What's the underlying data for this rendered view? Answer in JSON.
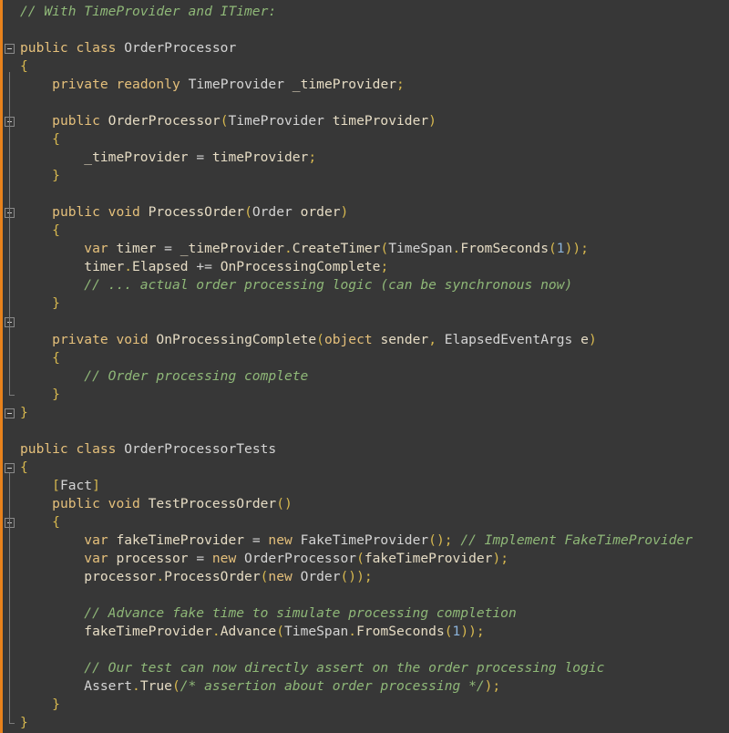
{
  "editor": {
    "language": "csharp",
    "colors": {
      "background": "#373737",
      "accent_bar": "#e8821c",
      "keyword": "#e5c07b",
      "comment": "#8fb878",
      "text": "#d4d4d4",
      "number": "#8cb4dc"
    },
    "fold_markers": [
      3,
      7,
      12,
      18,
      23,
      26,
      29
    ]
  },
  "lines": [
    [
      [
        "cm",
        "// With TimeProvider and ITimer:"
      ]
    ],
    [],
    [
      [
        "kw",
        "public"
      ],
      [
        "op",
        " "
      ],
      [
        "kw",
        "class"
      ],
      [
        "op",
        " "
      ],
      [
        "ty",
        "OrderProcessor"
      ]
    ],
    [
      [
        "pn",
        "{"
      ]
    ],
    [
      [
        "op",
        "    "
      ],
      [
        "kw",
        "private"
      ],
      [
        "op",
        " "
      ],
      [
        "kw",
        "readonly"
      ],
      [
        "op",
        " "
      ],
      [
        "ty",
        "TimeProvider"
      ],
      [
        "op",
        " "
      ],
      [
        "id",
        "_timeProvider"
      ],
      [
        "pn",
        ";"
      ]
    ],
    [],
    [
      [
        "op",
        "    "
      ],
      [
        "kw",
        "public"
      ],
      [
        "op",
        " "
      ],
      [
        "fn",
        "OrderProcessor"
      ],
      [
        "pn",
        "("
      ],
      [
        "ty",
        "TimeProvider"
      ],
      [
        "op",
        " "
      ],
      [
        "id",
        "timeProvider"
      ],
      [
        "pn",
        ")"
      ]
    ],
    [
      [
        "op",
        "    "
      ],
      [
        "pn",
        "{"
      ]
    ],
    [
      [
        "op",
        "        "
      ],
      [
        "id",
        "_timeProvider"
      ],
      [
        "op",
        " = "
      ],
      [
        "id",
        "timeProvider"
      ],
      [
        "pn",
        ";"
      ]
    ],
    [
      [
        "op",
        "    "
      ],
      [
        "pn",
        "}"
      ]
    ],
    [],
    [
      [
        "op",
        "    "
      ],
      [
        "kw",
        "public"
      ],
      [
        "op",
        " "
      ],
      [
        "kw",
        "void"
      ],
      [
        "op",
        " "
      ],
      [
        "fn",
        "ProcessOrder"
      ],
      [
        "pn",
        "("
      ],
      [
        "ty",
        "Order"
      ],
      [
        "op",
        " "
      ],
      [
        "id",
        "order"
      ],
      [
        "pn",
        ")"
      ]
    ],
    [
      [
        "op",
        "    "
      ],
      [
        "pn",
        "{"
      ]
    ],
    [
      [
        "op",
        "        "
      ],
      [
        "kw",
        "var"
      ],
      [
        "op",
        " "
      ],
      [
        "id",
        "timer"
      ],
      [
        "op",
        " = "
      ],
      [
        "id",
        "_timeProvider"
      ],
      [
        "pn",
        "."
      ],
      [
        "fn",
        "CreateTimer"
      ],
      [
        "pn",
        "("
      ],
      [
        "ty",
        "TimeSpan"
      ],
      [
        "pn",
        "."
      ],
      [
        "fn",
        "FromSeconds"
      ],
      [
        "pn",
        "("
      ],
      [
        "nm",
        "1"
      ],
      [
        "pn",
        "));"
      ]
    ],
    [
      [
        "op",
        "        "
      ],
      [
        "id",
        "timer"
      ],
      [
        "pn",
        "."
      ],
      [
        "id",
        "Elapsed"
      ],
      [
        "op",
        " += "
      ],
      [
        "id",
        "OnProcessingComplete"
      ],
      [
        "pn",
        ";"
      ]
    ],
    [
      [
        "op",
        "        "
      ],
      [
        "cm",
        "// ... actual order processing logic (can be synchronous now)"
      ]
    ],
    [
      [
        "op",
        "    "
      ],
      [
        "pn",
        "}"
      ]
    ],
    [],
    [
      [
        "op",
        "    "
      ],
      [
        "kw",
        "private"
      ],
      [
        "op",
        " "
      ],
      [
        "kw",
        "void"
      ],
      [
        "op",
        " "
      ],
      [
        "fn",
        "OnProcessingComplete"
      ],
      [
        "pn",
        "("
      ],
      [
        "kw",
        "object"
      ],
      [
        "op",
        " "
      ],
      [
        "id",
        "sender"
      ],
      [
        "pn",
        ", "
      ],
      [
        "ty",
        "ElapsedEventArgs"
      ],
      [
        "op",
        " "
      ],
      [
        "id",
        "e"
      ],
      [
        "pn",
        ")"
      ]
    ],
    [
      [
        "op",
        "    "
      ],
      [
        "pn",
        "{"
      ]
    ],
    [
      [
        "op",
        "        "
      ],
      [
        "cm",
        "// Order processing complete"
      ]
    ],
    [
      [
        "op",
        "    "
      ],
      [
        "pn",
        "}"
      ]
    ],
    [
      [
        "pn",
        "}"
      ]
    ],
    [],
    [
      [
        "kw",
        "public"
      ],
      [
        "op",
        " "
      ],
      [
        "kw",
        "class"
      ],
      [
        "op",
        " "
      ],
      [
        "ty",
        "OrderProcessorTests"
      ]
    ],
    [
      [
        "pn",
        "{"
      ]
    ],
    [
      [
        "op",
        "    "
      ],
      [
        "at",
        "["
      ],
      [
        "ty",
        "Fact"
      ],
      [
        "at",
        "]"
      ]
    ],
    [
      [
        "op",
        "    "
      ],
      [
        "kw",
        "public"
      ],
      [
        "op",
        " "
      ],
      [
        "kw",
        "void"
      ],
      [
        "op",
        " "
      ],
      [
        "fn",
        "TestProcessOrder"
      ],
      [
        "pn",
        "()"
      ]
    ],
    [
      [
        "op",
        "    "
      ],
      [
        "pn",
        "{"
      ]
    ],
    [
      [
        "op",
        "        "
      ],
      [
        "kw",
        "var"
      ],
      [
        "op",
        " "
      ],
      [
        "id",
        "fakeTimeProvider"
      ],
      [
        "op",
        " = "
      ],
      [
        "kw",
        "new"
      ],
      [
        "op",
        " "
      ],
      [
        "ty",
        "FakeTimeProvider"
      ],
      [
        "pn",
        "();"
      ],
      [
        "op",
        " "
      ],
      [
        "cm",
        "// Implement FakeTimeProvider"
      ]
    ],
    [
      [
        "op",
        "        "
      ],
      [
        "kw",
        "var"
      ],
      [
        "op",
        " "
      ],
      [
        "id",
        "processor"
      ],
      [
        "op",
        " = "
      ],
      [
        "kw",
        "new"
      ],
      [
        "op",
        " "
      ],
      [
        "ty",
        "OrderProcessor"
      ],
      [
        "pn",
        "("
      ],
      [
        "id",
        "fakeTimeProvider"
      ],
      [
        "pn",
        ");"
      ]
    ],
    [
      [
        "op",
        "        "
      ],
      [
        "id",
        "processor"
      ],
      [
        "pn",
        "."
      ],
      [
        "fn",
        "ProcessOrder"
      ],
      [
        "pn",
        "("
      ],
      [
        "kw",
        "new"
      ],
      [
        "op",
        " "
      ],
      [
        "ty",
        "Order"
      ],
      [
        "pn",
        "());"
      ]
    ],
    [],
    [
      [
        "op",
        "        "
      ],
      [
        "cm",
        "// Advance fake time to simulate processing completion"
      ]
    ],
    [
      [
        "op",
        "        "
      ],
      [
        "id",
        "fakeTimeProvider"
      ],
      [
        "pn",
        "."
      ],
      [
        "fn",
        "Advance"
      ],
      [
        "pn",
        "("
      ],
      [
        "ty",
        "TimeSpan"
      ],
      [
        "pn",
        "."
      ],
      [
        "fn",
        "FromSeconds"
      ],
      [
        "pn",
        "("
      ],
      [
        "nm",
        "1"
      ],
      [
        "pn",
        "));"
      ]
    ],
    [],
    [
      [
        "op",
        "        "
      ],
      [
        "cm",
        "// Our test can now directly assert on the order processing logic"
      ]
    ],
    [
      [
        "op",
        "        "
      ],
      [
        "ty",
        "Assert"
      ],
      [
        "pn",
        "."
      ],
      [
        "fn",
        "True"
      ],
      [
        "pn",
        "("
      ],
      [
        "cm",
        "/* assertion about order processing */"
      ],
      [
        "pn",
        ");"
      ]
    ],
    [
      [
        "op",
        "    "
      ],
      [
        "pn",
        "}"
      ]
    ],
    [
      [
        "pn",
        "}"
      ]
    ]
  ]
}
